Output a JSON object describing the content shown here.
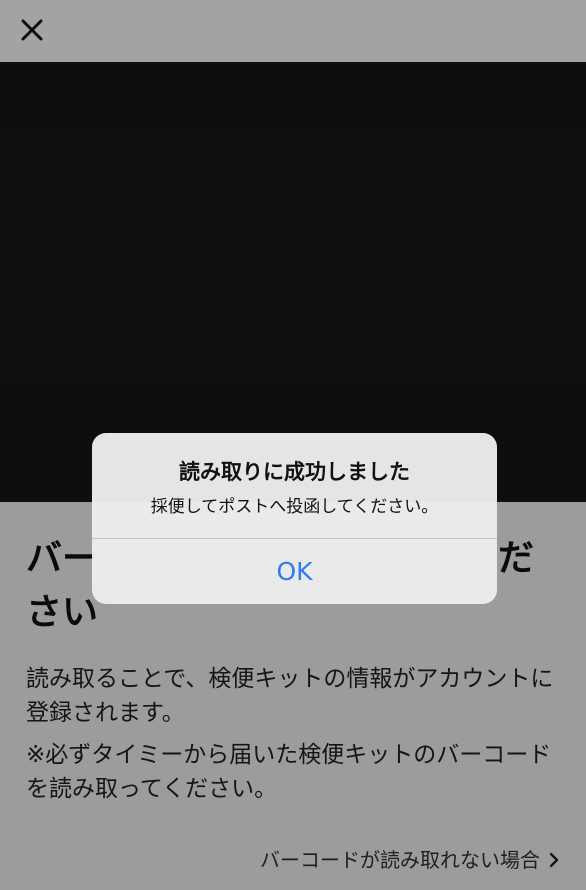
{
  "top_bar": {
    "close_icon": "close-icon"
  },
  "content": {
    "heading_line1_start": "バー",
    "heading_line1_end": "だ",
    "heading_line2": "さい",
    "description": "読み取ることで、検便キットの情報がアカウントに登録されます。",
    "note": "※必ずタイミーから届いた検便キットのバーコードを読み取ってください。",
    "help_link_label": "バーコードが読み取れない場合",
    "help_link_icon": "chevron-right-icon"
  },
  "alert": {
    "title": "読み取りに成功しました",
    "message": "採便してポストへ投函してください。",
    "ok_label": "OK",
    "ok_color": "#2f7bf0"
  }
}
